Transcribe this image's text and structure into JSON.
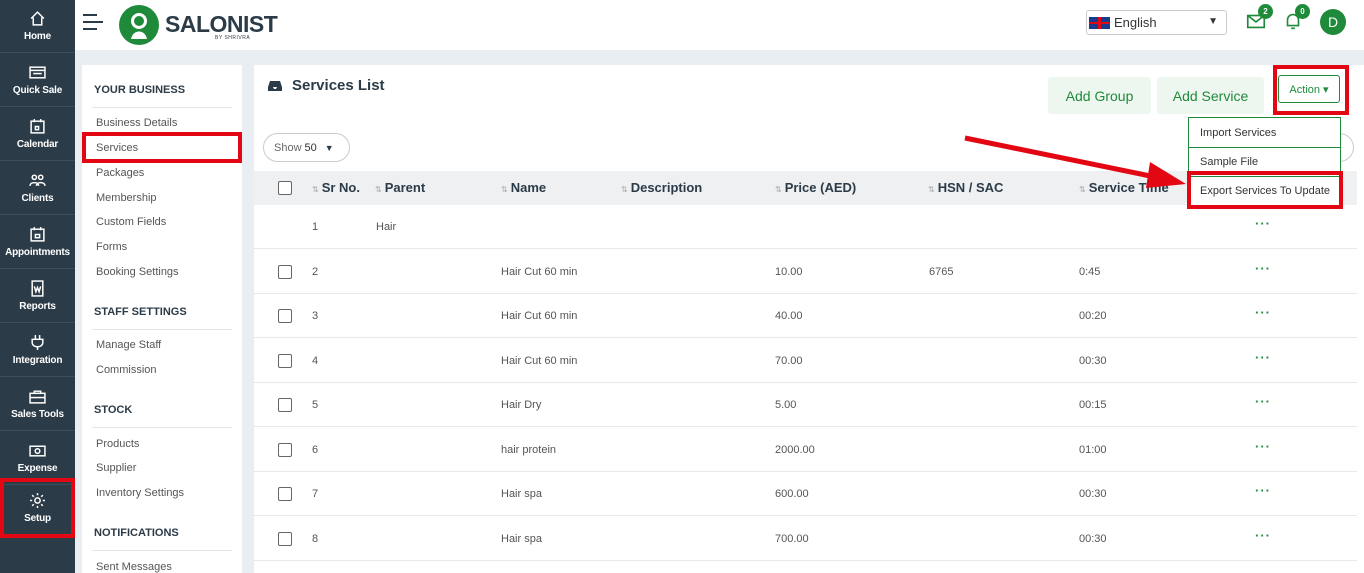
{
  "leftnav": {
    "items": [
      {
        "label": "Home",
        "icon": "home-icon"
      },
      {
        "label": "Quick Sale",
        "icon": "register-icon"
      },
      {
        "label": "Calendar",
        "icon": "calendar-icon"
      },
      {
        "label": "Clients",
        "icon": "clients-icon"
      },
      {
        "label": "Appointments",
        "icon": "appointment-icon"
      },
      {
        "label": "Reports",
        "icon": "report-icon"
      },
      {
        "label": "Integration",
        "icon": "plug-icon"
      },
      {
        "label": "Sales Tools",
        "icon": "briefcase-icon"
      },
      {
        "label": "Expense",
        "icon": "money-icon"
      },
      {
        "label": "Setup",
        "icon": "gear-icon"
      }
    ]
  },
  "topbar": {
    "brand": "SALONIST",
    "brand_sub": "BY SHRIVRA",
    "language": "English",
    "messages_count": "2",
    "notifications_count": "0",
    "avatar_initial": "D"
  },
  "settings": {
    "your_business": "YOUR BUSINESS",
    "business_items": [
      "Business Details",
      "Services",
      "Packages",
      "Membership",
      "Custom Fields",
      "Forms",
      "Booking Settings"
    ],
    "staff_settings": "STAFF SETTINGS",
    "staff_items": [
      "Manage Staff",
      "Commission"
    ],
    "stock": "STOCK",
    "stock_items": [
      "Products",
      "Supplier",
      "Inventory Settings"
    ],
    "notifications": "NOTIFICATIONS",
    "notification_items": [
      "Sent Messages"
    ]
  },
  "main": {
    "title": "Services List",
    "add_group": "Add Group",
    "add_service": "Add Service",
    "action": "Action ▾",
    "show_label": "Show",
    "show_value": "50",
    "columns": [
      "Sr No.",
      "Parent",
      "Name",
      "Description",
      "Price (AED)",
      "HSN / SAC",
      "Service Time"
    ],
    "rows": [
      {
        "sr": "1",
        "parent": "Hair",
        "name": "",
        "price": "",
        "hsn": "",
        "time": ""
      },
      {
        "sr": "2",
        "parent": "",
        "name": "Hair Cut 60 min",
        "price": "10.00",
        "hsn": "6765",
        "time": "0:45"
      },
      {
        "sr": "3",
        "parent": "",
        "name": "Hair Cut 60 min",
        "price": "40.00",
        "hsn": "",
        "time": "00:20"
      },
      {
        "sr": "4",
        "parent": "",
        "name": "Hair Cut 60 min",
        "price": "70.00",
        "hsn": "",
        "time": "00:30"
      },
      {
        "sr": "5",
        "parent": "",
        "name": "Hair Dry",
        "price": "5.00",
        "hsn": "",
        "time": "00:15"
      },
      {
        "sr": "6",
        "parent": "",
        "name": "hair protein",
        "price": "2000.00",
        "hsn": "",
        "time": "01:00"
      },
      {
        "sr": "7",
        "parent": "",
        "name": "Hair spa",
        "price": "600.00",
        "hsn": "",
        "time": "00:30"
      },
      {
        "sr": "8",
        "parent": "",
        "name": "Hair spa",
        "price": "700.00",
        "hsn": "",
        "time": "00:30"
      }
    ],
    "row_menu": "···",
    "action_menu": [
      "Import Services",
      "Sample File",
      "Export Services To Update"
    ]
  },
  "colors": {
    "accent": "#1f8a3a",
    "nav": "#2b3b47",
    "highlight": "#e30613"
  }
}
